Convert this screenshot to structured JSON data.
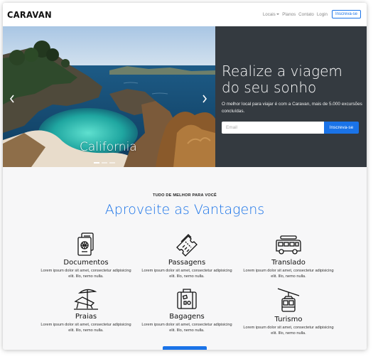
{
  "nav": {
    "brand": "CARAVAN",
    "links": [
      "Locais",
      "Planos",
      "Contato",
      "Login"
    ],
    "signup_button": "Inscreva-se"
  },
  "hero": {
    "title": "Realize a viagem do seu sonho",
    "subtitle": "O melhor local para viajar é com a Caravan, mais de 5.000 excursões concluídas.",
    "email_placeholder": "Email",
    "signup_button": "Inscreva-se",
    "slide_caption": "California"
  },
  "section": {
    "eyebrow": "TUDO DE MELHOR PARA VOCÊ",
    "title": "Aproveite as Vantagens",
    "features": [
      {
        "icon": "passport-icon",
        "title": "Documentos",
        "desc": "Lorem ipsum dolor sit amet, consectetur adipisicing elit. Illo, nemo nulla."
      },
      {
        "icon": "tickets-icon",
        "title": "Passagens",
        "desc": "Lorem ipsum dolor sit amet, consectetur adipisicing elit. Illo, nemo nulla."
      },
      {
        "icon": "van-icon",
        "title": "Translado",
        "desc": "Lorem ipsum dolor sit amet, consectetur adipisicing elit. Illo, nemo nulla."
      },
      {
        "icon": "beach-chair-icon",
        "title": "Praias",
        "desc": "Lorem ipsum dolor sit amet, consectetur adipisicing elit. Illo, nemo nulla."
      },
      {
        "icon": "luggage-icon",
        "title": "Bagagens",
        "desc": "Lorem ipsum dolor sit amet, consectetur adipisicing elit. Illo, nemo nulla."
      },
      {
        "icon": "cable-car-icon",
        "title": "Turismo",
        "desc": "Lorem ipsum dolor sit amet, consectetur adipisicing elit. Illo, nemo nulla."
      }
    ]
  },
  "colors": {
    "accent": "#1a73e8",
    "hero_panel": "#343a40"
  }
}
